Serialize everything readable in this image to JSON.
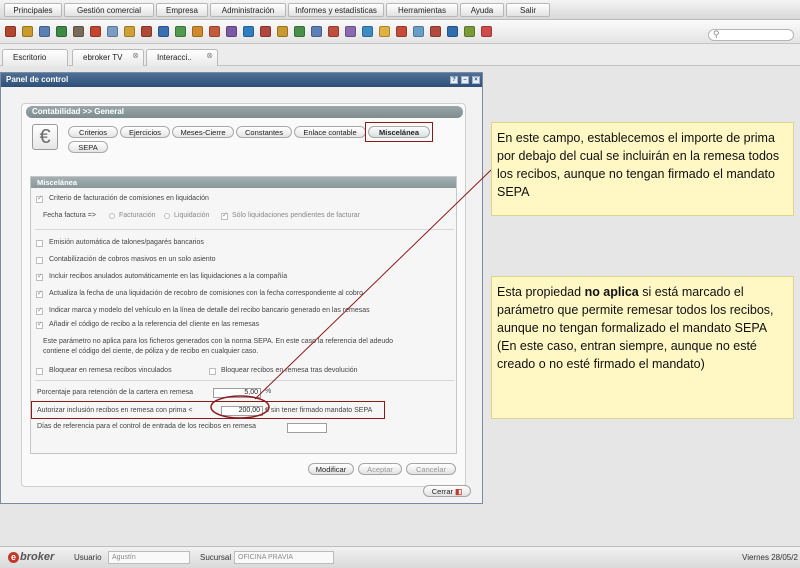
{
  "menubar": [
    "Principales",
    "Gestión comercial",
    "Empresa",
    "Administración",
    "Informes y estadísticas",
    "Herramientas",
    "Ayuda",
    "Salir"
  ],
  "iconbar": {
    "icon_colors": [
      "#b3462c",
      "#c99a2e",
      "#5a7fb5",
      "#3d8a46",
      "#7a6a5a",
      "#c4452f",
      "#7b9cc4",
      "#d0a035",
      "#b04838",
      "#3b6fb3",
      "#4f9a4c",
      "#d08a2a",
      "#c45a3a",
      "#7d5aa8",
      "#2f7fc0",
      "#b0463c",
      "#c89a30",
      "#4a8f4a",
      "#5d7fb8",
      "#c0503e",
      "#8a6ab0",
      "#3c8bc2",
      "#e0b040",
      "#c44c3a",
      "#6a9ec8",
      "#b24a40",
      "#2f6fb0",
      "#7a9a3a",
      "#d04a4a"
    ]
  },
  "tabs": [
    {
      "label": "Escritorio",
      "closable": false
    },
    {
      "label": "ebroker TV",
      "closable": true
    },
    {
      "label": "Interacci..",
      "closable": true
    }
  ],
  "panel": {
    "title": "Panel de control",
    "section_title": "Contabilidad >> General",
    "euro_symbol": "€",
    "subtabs": [
      "Criterios",
      "Ejercicios",
      "Meses-Cierre",
      "Constantes",
      "Enlace contable",
      "Miscelánea",
      "SEPA"
    ],
    "active_subtab": "Miscelánea"
  },
  "misc": {
    "header": "Miscelánea",
    "criterio_label": "Criterio de facturación de comisiones en liquidación",
    "fecha_factura_label": "Fecha factura =>",
    "radio_facturacion": "Facturación",
    "radio_liquidacion": "Liquidación",
    "solo_liquidaciones": "Sólo liquidaciones pendientes de facturar",
    "options": [
      "Emisión automática de talones/pagarés bancarios",
      "Contabilización de cobros masivos en un solo asiento",
      "Incluir recibos anulados automáticamente en las liquidaciones a la compañía",
      "Actualiza la fecha de una liquidación de recobro de comisiones con la fecha correspondiente al cobro",
      "Indicar marca y modelo del vehículo en la línea de detalle del recibo bancario generado en las remesas",
      "Añadir el código de recibo a la referencia del cliente en las remesas"
    ],
    "sepa_note_1": "Este parámetro no aplica para los ficheros generados con la norma SEPA. En este caso la referencia del adeudo",
    "sepa_note_2": "contiene el código del ciente, de póliza y de recibo en cualquier caso.",
    "bloquear_vinculados": "Bloquear en remesa recibos vinculados",
    "bloquear_devolucion": "Bloquear recibos en remesa tras devolución",
    "porcentaje_label": "Porcentaje para retención de la cartera en remesa",
    "porcentaje_value": "5,00",
    "porcentaje_unit": "%",
    "autorizar_label": "Autorizar inclusión recibos en remesa con prima <",
    "autorizar_value": "200,00",
    "autorizar_suffix": "€ sin tener firmado mandato SEPA",
    "dias_label": "Días de referencia para el control de entrada de los recibos en remesa",
    "dias_value": ""
  },
  "buttons": {
    "modificar": "Modificar",
    "aceptar": "Aceptar",
    "cancelar": "Cancelar",
    "cerrar": "Cerrar"
  },
  "callout_1": "En este campo, establecemos el importe de prima por debajo del cual se incluirán en la remesa todos los recibos, aunque no tengan firmado el mandato SEPA",
  "callout_2": {
    "part1": "Esta propiedad ",
    "bold": "no aplica",
    "part2": " si está marcado el parámetro que permite remesar todos los recibos, aunque no tengan formalizado el mandato SEPA (En este caso, entran siempre, aunque no esté creado o no esté firmado el mandato)"
  },
  "statusbar": {
    "brand": "broker",
    "brand_mark": "e",
    "usuario_label": "Usuario",
    "usuario_value": "Agustín",
    "sucursal_label": "Sucursal",
    "sucursal_value": "OFICINA PRAVIA",
    "date": "Viernes 28/05/2"
  },
  "colors": {
    "title_bar": "#2f4f77",
    "highlight": "#8b1a1a",
    "callout_bg": "#fff7c4"
  }
}
